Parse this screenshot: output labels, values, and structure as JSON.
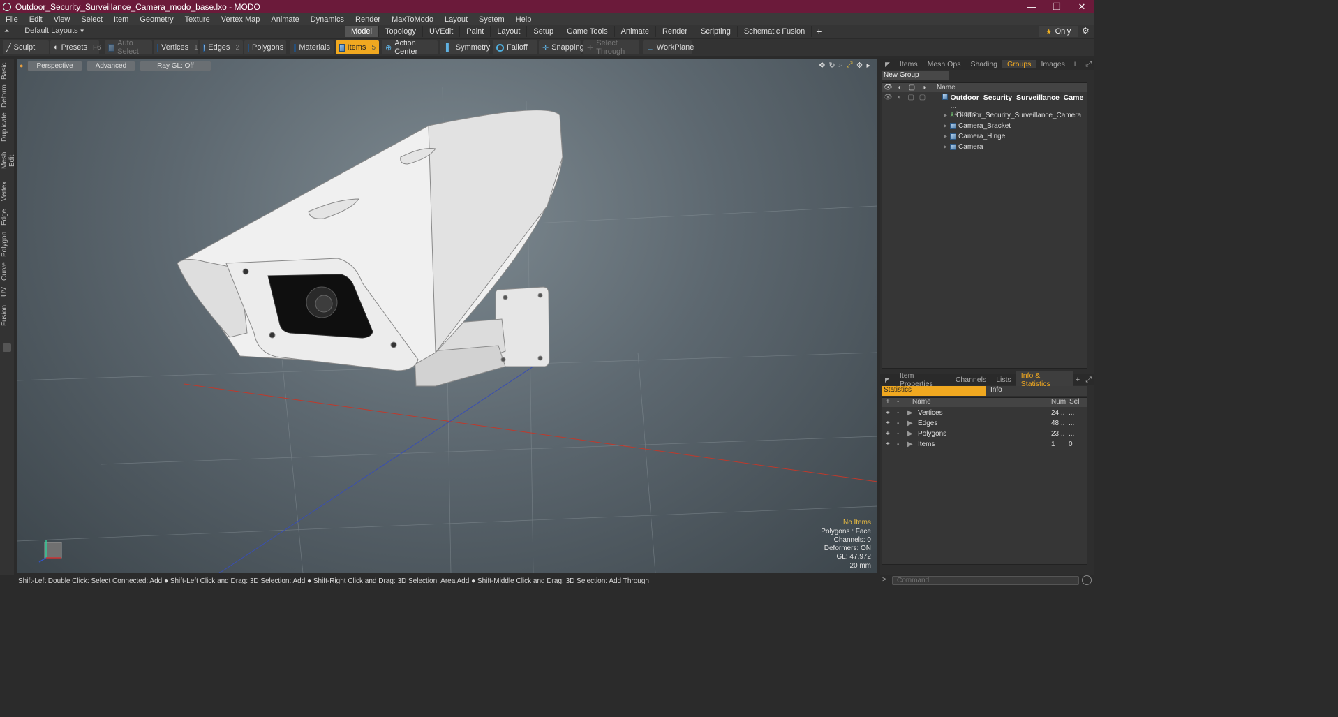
{
  "window": {
    "title": "Outdoor_Security_Surveillance_Camera_modo_base.lxo - MODO",
    "minimize": "—",
    "restore": "❐",
    "close": "✕"
  },
  "menu": [
    "File",
    "Edit",
    "View",
    "Select",
    "Item",
    "Geometry",
    "Texture",
    "Vertex Map",
    "Animate",
    "Dynamics",
    "Render",
    "MaxToModo",
    "Layout",
    "System",
    "Help"
  ],
  "layoutbar": {
    "default_layouts": "Default Layouts",
    "tabs": [
      "Model",
      "Topology",
      "UVEdit",
      "Paint",
      "Layout",
      "Setup",
      "Game Tools",
      "Animate",
      "Render",
      "Scripting",
      "Schematic Fusion"
    ],
    "active_tab": "Model",
    "only_label": "Only"
  },
  "toolbar": {
    "sculpt": "Sculpt",
    "presets": "Presets",
    "presets_hotkey": "F6",
    "auto_select": "Auto Select",
    "vertices": "Vertices",
    "vertices_hotkey": "1",
    "edges": "Edges",
    "edges_hotkey": "2",
    "polygons": "Polygons",
    "materials": "Materials",
    "items": "Items",
    "items_hotkey": "5",
    "action_center": "Action Center",
    "symmetry": "Symmetry",
    "falloff": "Falloff",
    "snapping": "Snapping",
    "select_through": "Select Through",
    "workplane": "WorkPlane"
  },
  "left_tabs": [
    "Basic",
    "Deform",
    "Duplicate",
    "Mesh Edit",
    "Vertex",
    "Edge",
    "Polygon",
    "Curve",
    "UV",
    "Fusion"
  ],
  "viewport": {
    "view_mode": "Perspective",
    "shading": "Advanced",
    "raygl": "Ray GL: Off",
    "info": {
      "no_items": "No Items",
      "polygons": "Polygons : Face",
      "channels": "Channels: 0",
      "deformers": "Deformers: ON",
      "gl": "GL: 47,972",
      "scale": "20 mm"
    }
  },
  "groups_panel": {
    "tabs": [
      "Items",
      "Mesh Ops",
      "Shading",
      "Groups",
      "Images"
    ],
    "active_tab": "Groups",
    "new_group": "New Group",
    "name_header": "Name",
    "root": "Outdoor_Security_Surveillance_Came ...",
    "root_count": "4 Items",
    "children": [
      "Outdoor_Security_Surveillance_Camera",
      "Camera_Bracket",
      "Camera_Hinge",
      "Camera"
    ]
  },
  "stats_panel": {
    "tabs": [
      "Item Properties",
      "Channels",
      "Lists",
      "Info & Statistics"
    ],
    "active_tab": "Info & Statistics",
    "sub_statistics": "Statistics",
    "sub_info": "Info",
    "col_name": "Name",
    "col_num": "Num",
    "col_sel": "Sel",
    "rows": [
      {
        "name": "Vertices",
        "num": "24...",
        "sel": "..."
      },
      {
        "name": "Edges",
        "num": "48...",
        "sel": "..."
      },
      {
        "name": "Polygons",
        "num": "23...",
        "sel": "..."
      },
      {
        "name": "Items",
        "num": "1",
        "sel": "0"
      }
    ]
  },
  "statusbar": "Shift-Left Double Click: Select Connected: Add ● Shift-Left Click and Drag: 3D Selection: Add ● Shift-Right Click and Drag: 3D Selection: Area Add ● Shift-Middle Click and Drag: 3D Selection: Add Through",
  "command_placeholder": "Command",
  "colors": {
    "accent": "#f0a820",
    "titlebar": "#6b1a3a"
  }
}
